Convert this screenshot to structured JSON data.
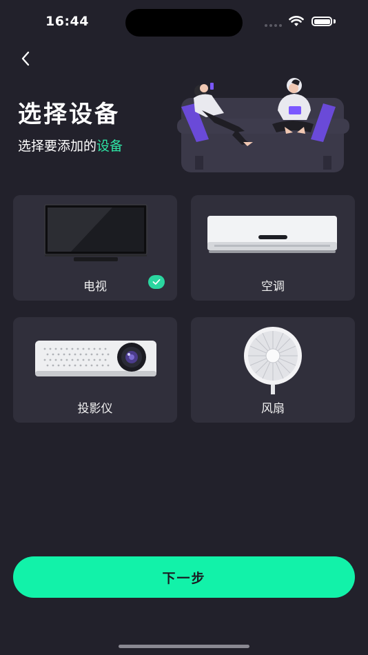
{
  "status_bar": {
    "time": "16:44"
  },
  "header": {
    "title": "选择设备",
    "subtitle_prefix": "选择要添加的",
    "subtitle_accent": "设备"
  },
  "devices": [
    {
      "label": "电视",
      "icon": "tv-icon",
      "selected": true
    },
    {
      "label": "空调",
      "icon": "air-conditioner-icon",
      "selected": false
    },
    {
      "label": "投影仪",
      "icon": "projector-icon",
      "selected": false
    },
    {
      "label": "风扇",
      "icon": "fan-icon",
      "selected": false
    }
  ],
  "footer": {
    "next_label": "下一步"
  },
  "colors": {
    "background": "#22212b",
    "card": "#302f3b",
    "accent": "#12f2a9",
    "accent_text": "#2ee6a6"
  }
}
